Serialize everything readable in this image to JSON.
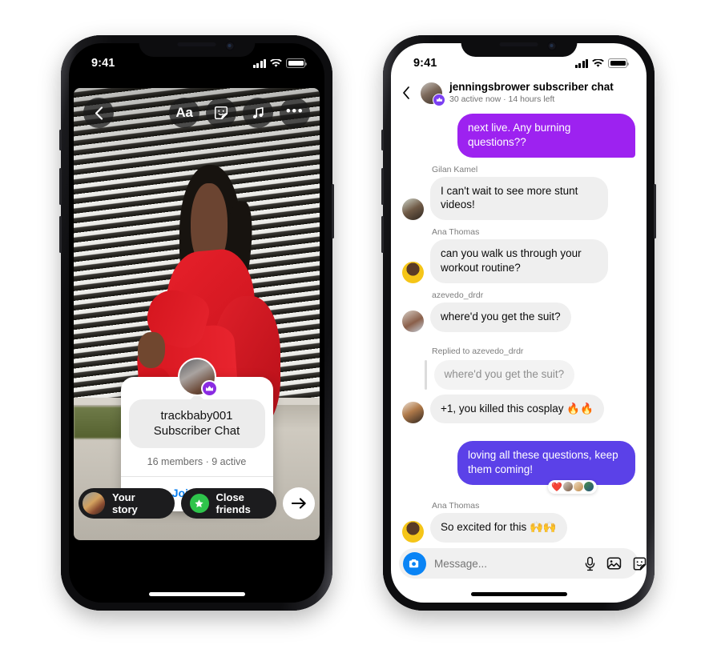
{
  "left_phone": {
    "status_bar": {
      "time": "9:41",
      "signal_icon": "cellular-bars-icon",
      "wifi_icon": "wifi-icon",
      "battery_icon": "battery-icon"
    },
    "story": {
      "back_icon": "back-chevron-icon",
      "tools": [
        {
          "name": "text-tool",
          "label": "Aa",
          "icon": "text-aa-icon"
        },
        {
          "name": "sticker-tool",
          "label": "",
          "icon": "sticker-smiley-icon"
        },
        {
          "name": "music-tool",
          "label": "",
          "icon": "music-note-icon"
        },
        {
          "name": "more-tool",
          "label": "•••",
          "icon": "more-dots-icon"
        }
      ],
      "card": {
        "avatar_badge_icon": "crown-icon",
        "username": "trackbaby001",
        "chat_label": "Subscriber Chat",
        "meta": "16 members · 9 active",
        "join_label": "Join chat"
      },
      "bottom_bar": {
        "your_story_label": "Your story",
        "close_friends_label": "Close friends",
        "close_friends_icon": "green-star-icon",
        "send_icon": "arrow-right-icon"
      }
    }
  },
  "right_phone": {
    "status_bar": {
      "time": "9:41",
      "signal_icon": "cellular-bars-icon",
      "wifi_icon": "wifi-icon",
      "battery_icon": "battery-icon"
    },
    "header": {
      "back_icon": "back-chevron-icon",
      "avatar_badge_icon": "crown-icon",
      "title": "jenningsbrower subscriber chat",
      "subtitle": "30 active now · 14 hours left"
    },
    "messages": [
      {
        "id": "m1",
        "direction": "out",
        "style": "purple",
        "text": "next live. Any burning questions??"
      },
      {
        "id": "m2",
        "direction": "in",
        "sender": "Gilan Kamel",
        "text": "I can't wait to see more stunt videos!"
      },
      {
        "id": "m3",
        "direction": "in",
        "sender": "Ana Thomas",
        "text": "can you walk us through your workout routine?"
      },
      {
        "id": "m4",
        "direction": "in",
        "sender": "azevedo_drdr",
        "text": "where'd you get the suit?"
      },
      {
        "id": "m5",
        "direction": "in",
        "reply_label": "Replied to azevedo_drdr",
        "quoted_text": "where'd you get the suit?",
        "text": "+1, you killed this cosplay 🔥🔥"
      },
      {
        "id": "m6",
        "direction": "out",
        "style": "blue",
        "text": "loving all these questions, keep them coming!",
        "reactions": [
          "❤️",
          "avatar",
          "avatar",
          "avatar"
        ]
      },
      {
        "id": "m7",
        "direction": "in",
        "sender": "Ana Thomas",
        "text": "So excited for this 🙌🙌"
      }
    ],
    "composer": {
      "camera_icon": "camera-icon",
      "placeholder": "Message...",
      "mic_icon": "microphone-icon",
      "gallery_icon": "photo-gallery-icon",
      "sticker_icon": "sticker-smiley-icon"
    }
  },
  "colors": {
    "purple_bubble": "#9d22f0",
    "blue_bubble": "#5b41e8",
    "crown_badge": "#7b3ff2",
    "join_link": "#0a7ff0",
    "camera_blue": "#0a84f5",
    "close_friends_green": "#2ec44b",
    "incoming_bubble": "#efefef"
  }
}
